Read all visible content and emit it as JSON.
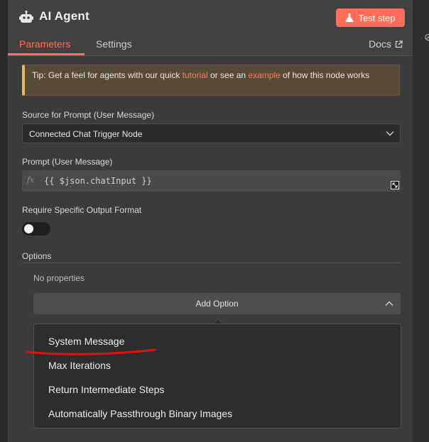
{
  "header": {
    "title": "AI Agent",
    "test_step_label": "Test step",
    "icon": "robot-icon",
    "accent_color": "#ff6d5a"
  },
  "tabs": {
    "parameters": "Parameters",
    "settings": "Settings",
    "docs": "Docs"
  },
  "tip": {
    "prefix": "Tip: Get a feel for agents with our quick ",
    "link1": "tutorial",
    "middle": " or see an ",
    "link2": "example",
    "suffix": " of how this node works"
  },
  "source_prompt": {
    "label": "Source for Prompt (User Message)",
    "value": "Connected Chat Trigger Node"
  },
  "prompt": {
    "label": "Prompt (User Message)",
    "value": "{{ $json.chatInput }}"
  },
  "output_format": {
    "label": "Require Specific Output Format",
    "enabled": false
  },
  "options": {
    "label": "Options",
    "empty_text": "No properties",
    "add_option_label": "Add Option",
    "dropdown_items": [
      "System Message",
      "Max Iterations",
      "Return Intermediate Steps",
      "Automatically Passthrough Binary Images"
    ]
  }
}
